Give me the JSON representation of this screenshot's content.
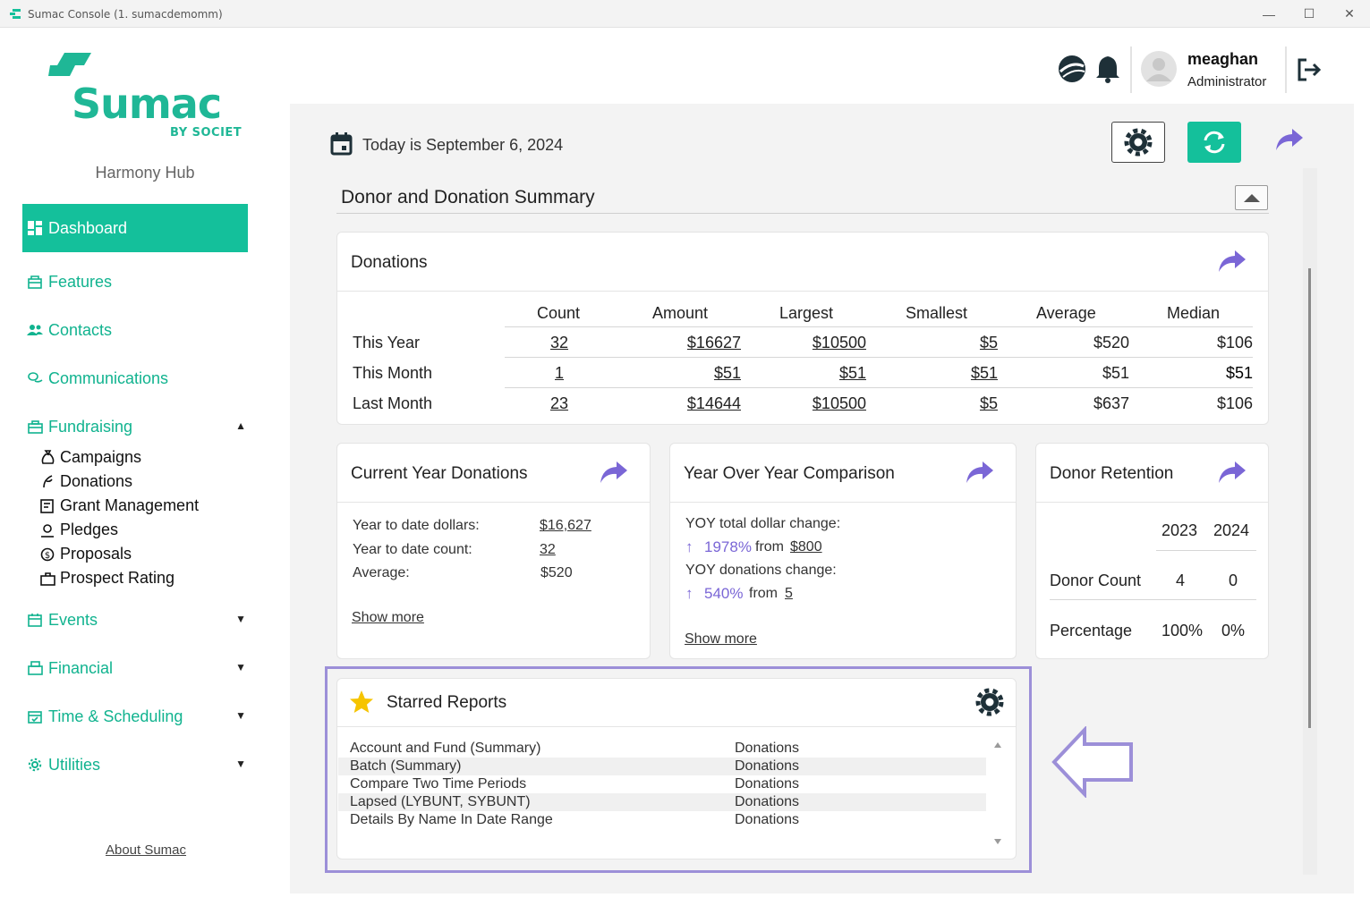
{
  "window": {
    "title": "Sumac Console (1. sumacdemomm)"
  },
  "brand": {
    "word": "Sumac",
    "tagline": "BY SOCIET",
    "color": "#14c09b"
  },
  "org_name": "Harmony Hub",
  "nav": {
    "dashboard": "Dashboard",
    "features": "Features",
    "contacts": "Contacts",
    "communications": "Communications",
    "fundraising": "Fundraising",
    "events": "Events",
    "financial": "Financial",
    "time_scheduling": "Time & Scheduling",
    "utilities": "Utilities",
    "fundraising_sub": {
      "campaigns": "Campaigns",
      "donations": "Donations",
      "grant_management": "Grant Management",
      "pledges": "Pledges",
      "proposals": "Proposals",
      "prospect_rating": "Prospect Rating"
    }
  },
  "about_link": "About Sumac",
  "user": {
    "name": "meaghan",
    "role": "Administrator"
  },
  "today": "Today is September 6, 2024",
  "section_title": "Donor and Donation Summary",
  "donations_card": {
    "title": "Donations",
    "headers": [
      "Count",
      "Amount",
      "Largest",
      "Smallest",
      "Average",
      "Median"
    ],
    "rows": [
      {
        "label": "This Year",
        "count": "32",
        "amount": "$16627",
        "largest": "$10500",
        "smallest": "$5",
        "average": "$520",
        "median": "$106"
      },
      {
        "label": "This Month",
        "count": "1",
        "amount": "$51",
        "largest": "$51",
        "smallest": "$51",
        "average": "$51",
        "median": "$51"
      },
      {
        "label": "Last Month",
        "count": "23",
        "amount": "$14644",
        "largest": "$10500",
        "smallest": "$5",
        "average": "$637",
        "median": "$106"
      }
    ]
  },
  "current_year": {
    "title": "Current Year Donations",
    "ytd_dollars_label": "Year to date dollars:",
    "ytd_dollars": "$16,627",
    "ytd_count_label": "Year to date count:",
    "ytd_count": "32",
    "average_label": "Average:",
    "average": "$520",
    "show_more": "Show more"
  },
  "yoy": {
    "title": "Year Over Year Comparison",
    "dollar_label": "YOY total dollar change:",
    "dollar_change": "1978%",
    "from_text": "from",
    "dollar_from": "$800",
    "donations_label": "YOY donations change:",
    "donations_change": "540%",
    "donations_from": "5",
    "show_more": "Show more"
  },
  "retention": {
    "title": "Donor Retention",
    "years": [
      "2023",
      "2024"
    ],
    "donor_count_label": "Donor Count",
    "donor_count": [
      "4",
      "0"
    ],
    "percentage_label": "Percentage",
    "percentage": [
      "100%",
      "0%"
    ]
  },
  "starred": {
    "title": "Starred Reports",
    "reports": [
      {
        "name": "Account and Fund (Summary)",
        "category": "Donations"
      },
      {
        "name": "Batch (Summary)",
        "category": "Donations"
      },
      {
        "name": "Compare Two Time Periods",
        "category": "Donations"
      },
      {
        "name": "Lapsed (LYBUNT, SYBUNT)",
        "category": "Donations"
      },
      {
        "name": "Details By Name In Date Range",
        "category": "Donations"
      }
    ]
  }
}
